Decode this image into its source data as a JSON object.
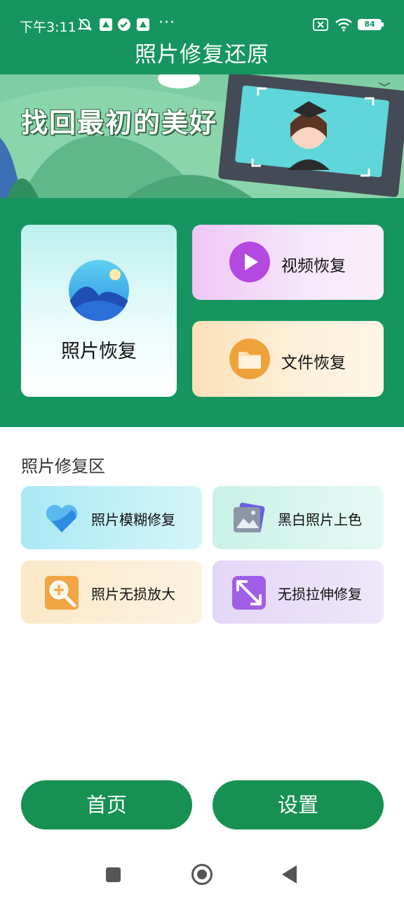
{
  "status_bar": {
    "time": "下午3:11",
    "dots": "···",
    "battery": "84",
    "icons": [
      "mute-bell-icon",
      "app-notify-icon",
      "check-circle-icon",
      "app-notify-icon",
      "sim-off-icon",
      "wifi-icon",
      "battery-icon"
    ]
  },
  "header": {
    "title": "照片修复还原"
  },
  "banner": {
    "slogan": "找回最初的美好"
  },
  "features": {
    "photo_recovery": "照片恢复",
    "video_recovery": "视频恢复",
    "file_recovery": "文件恢复"
  },
  "section": {
    "title": "照片修复区",
    "tools": [
      {
        "label": "照片模糊修复",
        "icon": "heart-icon"
      },
      {
        "label": "黑白照片上色",
        "icon": "image-stack-icon"
      },
      {
        "label": "照片无损放大",
        "icon": "zoom-in-icon"
      },
      {
        "label": "无损拉伸修复",
        "icon": "expand-arrows-icon"
      }
    ]
  },
  "bottom_nav": {
    "home": "首页",
    "settings": "设置"
  },
  "colors": {
    "primary": "#169560",
    "button": "#169152"
  }
}
